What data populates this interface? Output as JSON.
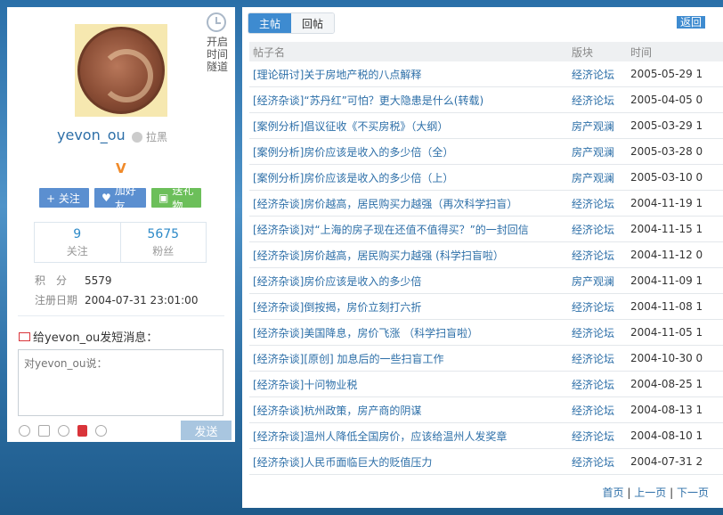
{
  "profile": {
    "timeline_toggle": "开启时间隧道",
    "username": "yevon_ou",
    "blacklist": "拉黑",
    "vip": "V",
    "buttons": {
      "follow": "+ 关注",
      "add_friend": "加好友",
      "send_gift": "送礼物"
    },
    "stats": [
      {
        "value": "9",
        "label": "关注"
      },
      {
        "value": "5675",
        "label": "粉丝"
      }
    ],
    "points_label": "积　分",
    "points_value": "5579",
    "reg_label": "注册日期",
    "reg_value": "2004-07-31 23:01:00"
  },
  "message": {
    "title": "给yevon_ou发短消息：",
    "placeholder": "对yevon_ou说：",
    "send": "发送"
  },
  "tabs": {
    "active": "主帖",
    "inactive": "回帖"
  },
  "back": "返回",
  "table": {
    "headers": {
      "title": "帖子名",
      "board": "版块",
      "time": "时间"
    },
    "rows": [
      {
        "title": "[理论研讨]关于房地产税的八点解释",
        "board": "经济论坛",
        "time": "2005-05-29 1"
      },
      {
        "title": "[经济杂谈]“苏丹红”可怕？更大隐患是什么(转载)",
        "board": "经济论坛",
        "time": "2005-04-05 0"
      },
      {
        "title": "[案例分析]倡议征收《不买房税》（大纲）",
        "board": "房产观澜",
        "time": "2005-03-29 1"
      },
      {
        "title": "[案例分析]房价应该是收入的多少倍（全）",
        "board": "房产观澜",
        "time": "2005-03-28 0"
      },
      {
        "title": "[案例分析]房价应该是收入的多少倍（上）",
        "board": "房产观澜",
        "time": "2005-03-10 0"
      },
      {
        "title": "[经济杂谈]房价越高，居民购买力越强（再次科学扫盲）",
        "board": "经济论坛",
        "time": "2004-11-19 1"
      },
      {
        "title": "[经济杂谈]对“上海的房子现在还值不值得买？”的一封回信",
        "board": "经济论坛",
        "time": "2004-11-15 1"
      },
      {
        "title": "[经济杂谈]房价越高，居民购买力越强 (科学扫盲啦）",
        "board": "经济论坛",
        "time": "2004-11-12 0"
      },
      {
        "title": "[经济杂谈]房价应该是收入的多少倍",
        "board": "房产观澜",
        "time": "2004-11-09 1"
      },
      {
        "title": "[经济杂谈]倒按揭，房价立刻打六折",
        "board": "经济论坛",
        "time": "2004-11-08 1"
      },
      {
        "title": "[经济杂谈]美国降息，房价飞涨 （科学扫盲啦）",
        "board": "经济论坛",
        "time": "2004-11-05 1"
      },
      {
        "title": "[经济杂谈][原创] 加息后的一些扫盲工作",
        "board": "经济论坛",
        "time": "2004-10-30 0"
      },
      {
        "title": "[经济杂谈]十问物业税",
        "board": "经济论坛",
        "time": "2004-08-25 1"
      },
      {
        "title": "[经济杂谈]杭州政策，房产商的阴谋",
        "board": "经济论坛",
        "time": "2004-08-13 1"
      },
      {
        "title": "[经济杂谈]温州人降低全国房价，应该给温州人发奖章",
        "board": "经济论坛",
        "time": "2004-08-10 1"
      },
      {
        "title": "[经济杂谈]人民币面临巨大的贬值压力",
        "board": "经济论坛",
        "time": "2004-07-31 2"
      }
    ]
  },
  "pager": {
    "first": "首页",
    "prev": "上一页",
    "next": "下一页",
    "sep": "|"
  }
}
